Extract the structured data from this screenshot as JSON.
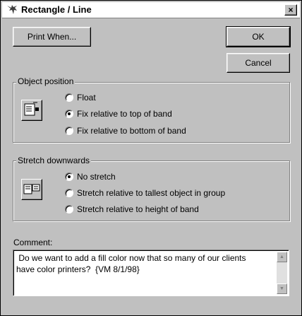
{
  "window": {
    "title": "Rectangle / Line",
    "close_label": "×"
  },
  "buttons": {
    "print_when": "Print When...",
    "ok": "OK",
    "cancel": "Cancel"
  },
  "object_position": {
    "label": "Object position",
    "options": [
      "Float",
      "Fix relative to top of band",
      "Fix relative to bottom of band"
    ],
    "selected": 1
  },
  "stretch": {
    "label": "Stretch downwards",
    "options": [
      "No stretch",
      "Stretch relative to tallest object in group",
      "Stretch relative to height of band"
    ],
    "selected": 0
  },
  "comment": {
    "label": "Comment:",
    "value": " Do we want to add a fill color now that so many of our clients\nhave color printers?  {VM 8/1/98}"
  }
}
